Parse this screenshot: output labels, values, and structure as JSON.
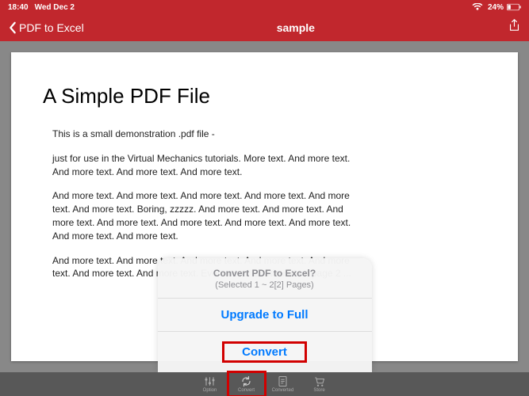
{
  "status": {
    "time": "18:40",
    "date": "Wed Dec 2",
    "battery": "24%"
  },
  "nav": {
    "back_label": "PDF to Excel",
    "title": "sample"
  },
  "pdf": {
    "title": "A Simple PDF File",
    "p1": "This is a small demonstration .pdf file -",
    "p2": "just for use in the Virtual Mechanics tutorials. More text. And more text. And more text. And more text. And more text.",
    "p3": "And more text. And more text. And more text. And more text. And more text. And more text. Boring, zzzzz. And more text. And more text. And more text. And more text. And more text. And more text. And more text. And more text. And more text.",
    "p4": "And more text. And more text. And more text. And more text. And more text. And more text. And more text. Even more. Continued on page 2 ..."
  },
  "popup": {
    "title": "Convert PDF to Excel?",
    "subtitle": "(Selected 1 ~ 2[2] Pages)",
    "upgrade": "Upgrade to Full",
    "convert": "Convert"
  },
  "tabs": {
    "option": "Option",
    "convert": "Convert",
    "converted": "Converted",
    "store": "Store"
  }
}
